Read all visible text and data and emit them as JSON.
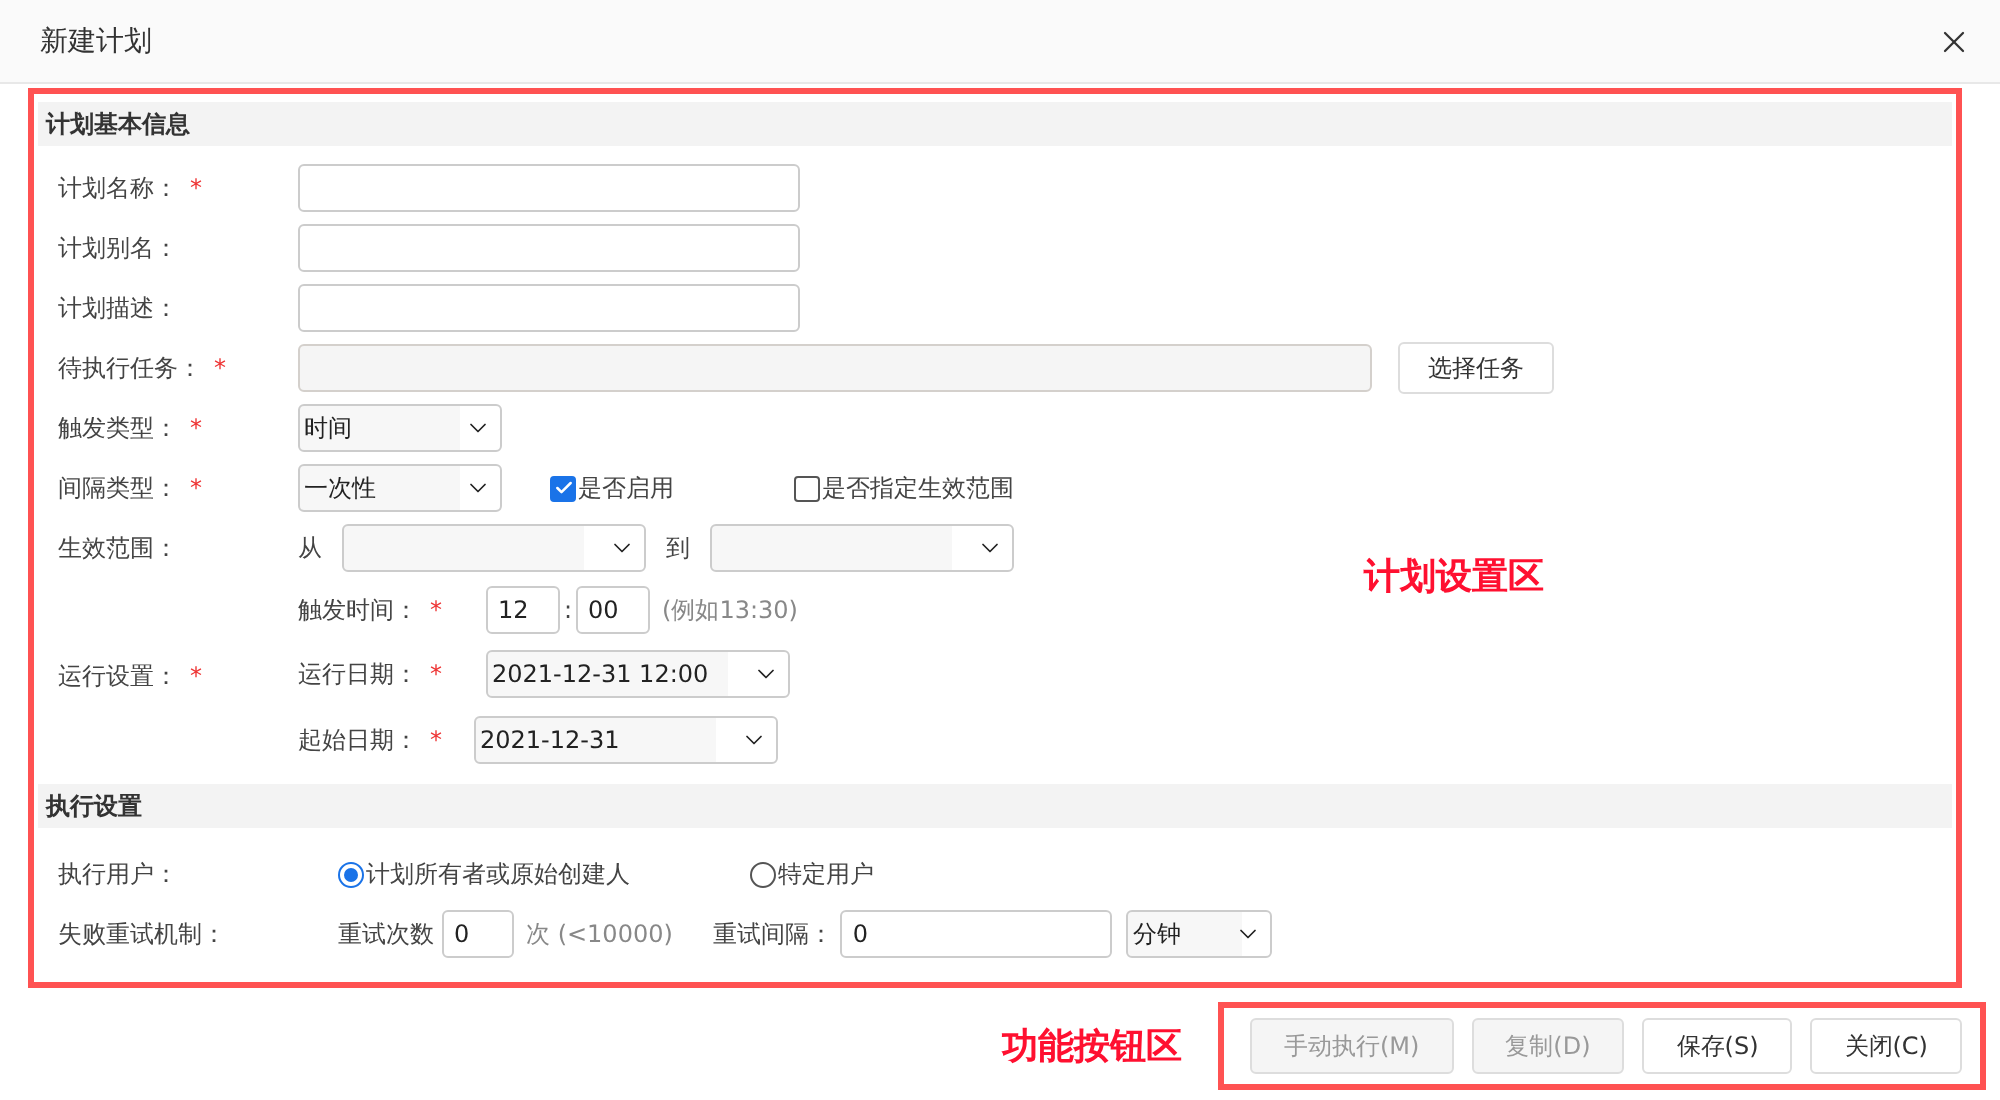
{
  "window": {
    "title": "新建计划"
  },
  "plan_section": {
    "title": "计划基本信息",
    "annotation": "计划设置区",
    "name": {
      "label": "计划名称：",
      "mark": "*"
    },
    "alias": {
      "label": "计划别名："
    },
    "description": {
      "label": "计划描述："
    },
    "task": {
      "label": "待执行任务：",
      "mark": "*",
      "button": "选择任务"
    },
    "trigger_type": {
      "label": "触发类型：",
      "mark": "*",
      "value": "时间"
    },
    "interval_type": {
      "label": "间隔类型：",
      "mark": "*",
      "value": "一次性",
      "checkboxes": [
        {
          "label": "是否启用",
          "checked": true
        },
        {
          "label": "是否指定生效范围",
          "checked": false
        }
      ]
    },
    "effective_range": {
      "label": "生效范围：",
      "from": "从",
      "to": "到"
    },
    "run_settings": {
      "label": "运行设置：",
      "mark": "*",
      "trigger_time": {
        "label": "触发时间：",
        "mark": "*",
        "hour": "12",
        "separator": ":",
        "minute": "00",
        "hint": "(例如13:30)"
      },
      "run_date": {
        "label": "运行日期：",
        "mark": "*",
        "value": "2021-12-31 12:00"
      },
      "start_date": {
        "label": "起始日期：",
        "mark": "*",
        "value": "2021-12-31"
      }
    }
  },
  "exec_section": {
    "title": "执行设置",
    "user": {
      "label": "执行用户：",
      "options": [
        {
          "label": "计划所有者或原始创建人",
          "selected": true
        },
        {
          "label": "特定用户",
          "selected": false
        }
      ]
    },
    "retry": {
      "label": "失败重试机制：",
      "count_label": "重试次数",
      "count": "0",
      "count_hint": "次 (<10000)",
      "interval_label": "重试间隔：",
      "interval": "0",
      "unit": "分钟"
    }
  },
  "footer": {
    "annotation": "功能按钮区",
    "buttons": [
      {
        "label": "手动执行(M)",
        "disabled": true
      },
      {
        "label": "复制(D)",
        "disabled": true
      },
      {
        "label": "保存(S)",
        "disabled": false
      },
      {
        "label": "关闭(C)",
        "disabled": false
      }
    ]
  }
}
